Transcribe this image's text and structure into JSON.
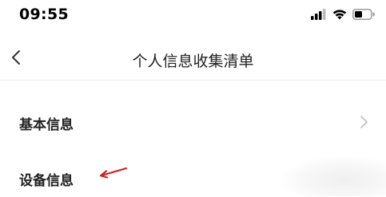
{
  "status_bar": {
    "time": "09:55",
    "icons": [
      "signal-icon",
      "wifi-icon",
      "battery-icon"
    ]
  },
  "nav": {
    "back_icon": "back-chevron-icon",
    "title": "个人信息收集清单"
  },
  "list": {
    "items": [
      {
        "label": "基本信息",
        "chevron_icon": "chevron-right-icon"
      },
      {
        "label": "设备信息"
      }
    ]
  },
  "annotation": {
    "arrow_icon": "red-arrow-icon",
    "color": "#d21f1f"
  }
}
